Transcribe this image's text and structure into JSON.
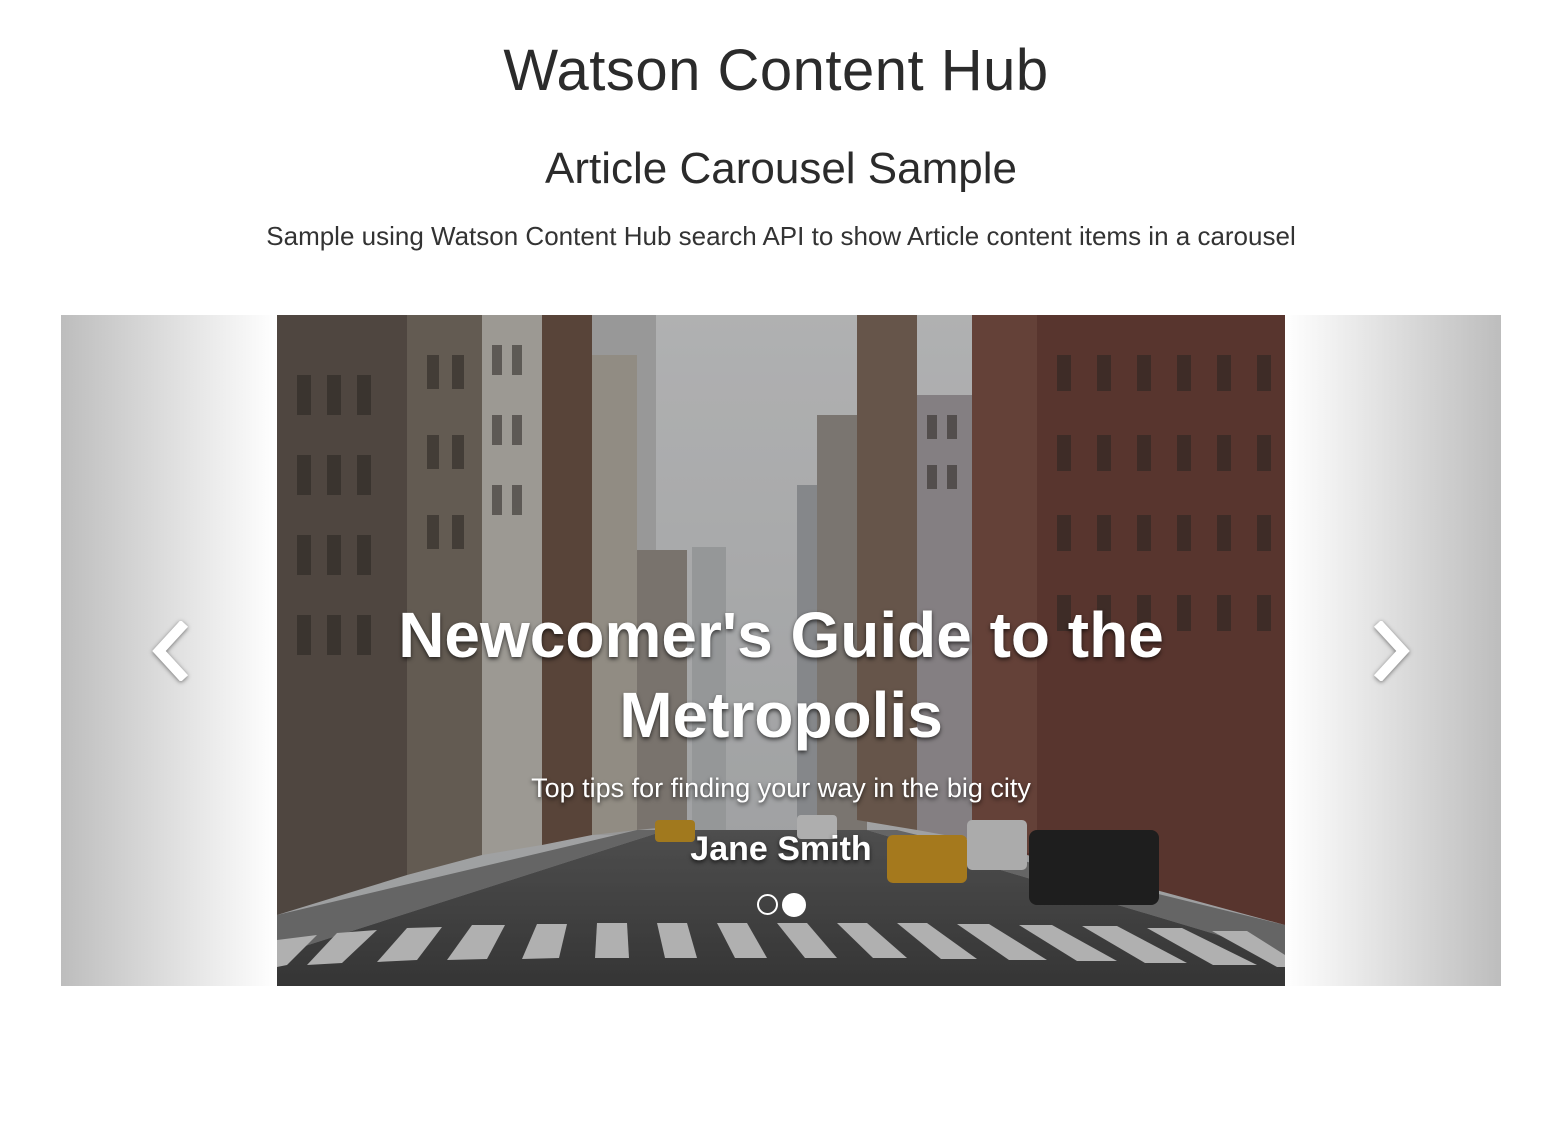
{
  "header": {
    "site_title": "Watson Content Hub",
    "sample_title": "Article Carousel Sample",
    "description": "Sample using Watson Content Hub search API to show Article content items in a carousel"
  },
  "carousel": {
    "prev_icon": "chevron-left-icon",
    "next_icon": "chevron-right-icon",
    "slide": {
      "title": "Newcomer's Guide to the Metropolis",
      "subtitle": "Top tips for finding your way in the big city",
      "author": "Jane Smith",
      "image": "city-street-photo"
    },
    "indicators": {
      "count": 2,
      "active_index": 1
    }
  },
  "colors": {
    "text": "#2b2b2b",
    "caption": "#ffffff",
    "side_gradient_dark": "#bdbdbd",
    "side_gradient_light": "#ffffff"
  }
}
